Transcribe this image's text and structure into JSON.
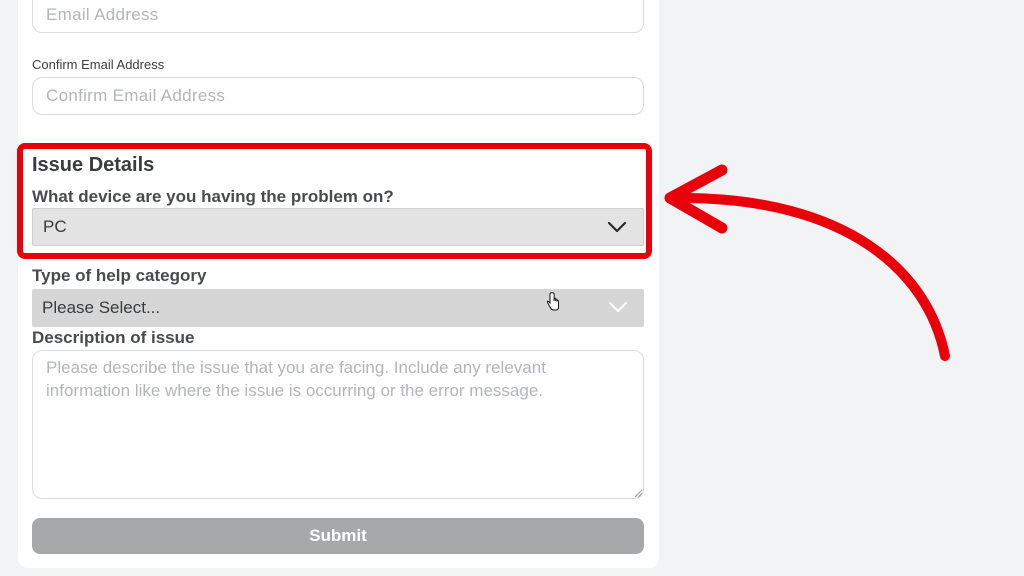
{
  "form": {
    "email_placeholder": "Email Address",
    "confirm_email_label": "Confirm Email Address",
    "confirm_email_placeholder": "Confirm Email Address",
    "issue_section_title": "Issue Details",
    "device_question": "What device are you having the problem on?",
    "device_selected": "PC",
    "category_label": "Type of help category",
    "category_selected": "Please Select...",
    "description_label": "Description of issue",
    "description_placeholder": "Please describe the issue that you are facing. Include any relevant information like where the issue is occurring or the error message.",
    "submit_label": "Submit"
  },
  "icons": {
    "dropdown": "chevron-down-icon",
    "pointer": "hand-pointer-icon",
    "annotation": "curved-arrow-icon"
  },
  "colors": {
    "highlight": "#e8000b",
    "submit_disabled": "#a7a8aa",
    "text": "#393b3d"
  }
}
